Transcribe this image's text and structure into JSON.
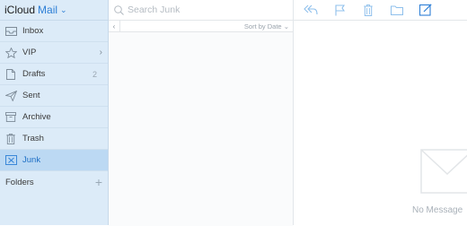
{
  "app": {
    "name": "iCloud",
    "product": "Mail"
  },
  "sidebar": {
    "items": [
      {
        "label": "Inbox",
        "icon": "inbox-icon"
      },
      {
        "label": "VIP",
        "icon": "star-icon"
      },
      {
        "label": "Drafts",
        "icon": "document-icon",
        "badge": "2"
      },
      {
        "label": "Sent",
        "icon": "paper-plane-icon"
      },
      {
        "label": "Archive",
        "icon": "archive-box-icon"
      },
      {
        "label": "Trash",
        "icon": "trash-icon"
      },
      {
        "label": "Junk",
        "icon": "junk-tray-icon"
      }
    ],
    "folders_label": "Folders",
    "add_symbol": "+"
  },
  "list": {
    "search_placeholder": "Search Junk",
    "sort_label": "Sort by Date",
    "sort_chevron": "⌄",
    "back_chevron": "‹"
  },
  "reader": {
    "empty_text": "No Message"
  },
  "colors": {
    "sidebar_bg": "#dcebf8",
    "active_bg": "#bcd9f3",
    "accent": "#2d7fd6",
    "toolbar_icon": "#8fc0ec"
  }
}
